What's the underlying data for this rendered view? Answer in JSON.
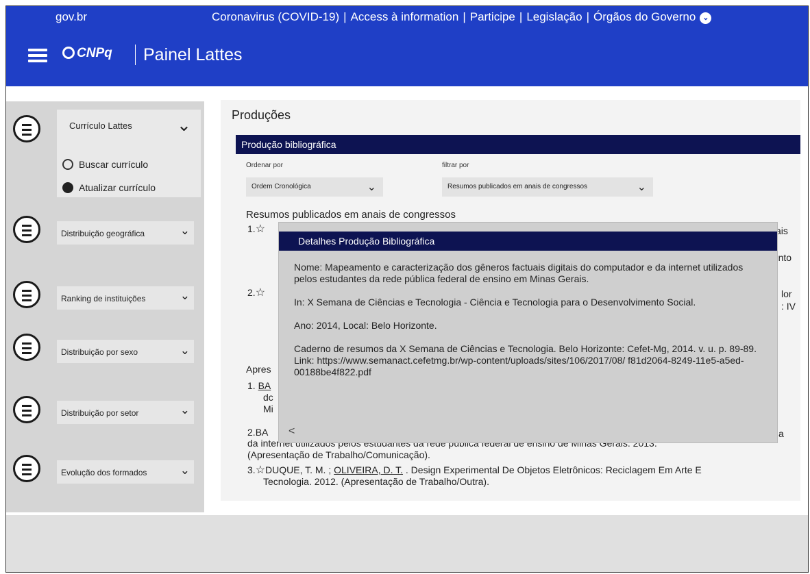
{
  "header": {
    "gov_label": "gov.br",
    "links": [
      "Coronavirus (COVID-19)",
      "Access à information",
      "Participe",
      "Legislação",
      "Órgãos do Governo"
    ],
    "logo_text": "CNPq",
    "title": "Painel Lattes"
  },
  "sidebar": {
    "curriculo": {
      "label": "Currículo Lattes",
      "sub_items": [
        {
          "label": "Buscar currículo",
          "icon": "search-icon"
        },
        {
          "label": "Atualizar currículo",
          "icon": "refresh-icon"
        }
      ]
    },
    "items": [
      {
        "label": "Distribuição geográfica"
      },
      {
        "label": "Ranking de instituições"
      },
      {
        "label": "Distribuição por sexo"
      },
      {
        "label": "Distribuição por setor"
      },
      {
        "label": "Evolução dos formados"
      }
    ]
  },
  "main": {
    "title": "Produções",
    "section_bar": "Produção bibliográfica",
    "order_label": "Ordenar por",
    "order_value": "Ordem Cronológica",
    "filter_label": "filtrar por",
    "filter_value": "Resumos publicados em anais de congressos",
    "list_title": "Resumos publicados em anais de congressos",
    "item1_num": "1.",
    "item2_num": "2.",
    "item1_tail": "ais",
    "item1_tail2": "nento",
    "item2_tail": "lor",
    "item2_tail2": ": IV",
    "apres_frag": "Apres",
    "apres1_num": "1.",
    "apres1_frag": "BA",
    "apres1_frag2": "dc",
    "apres1_frag3": "Mi",
    "apres2_num": "2.",
    "apres2_frag": "BA",
    "apres2_tail": "a",
    "apres2_line2": "da internet utilizados pelos estudantes da rede pública federal de ensino de Minas Gerais. 2013.",
    "apres2_line3": "(Apresentação de Trabalho/Comunicação).",
    "apres3_num": "3.",
    "apres3_line1_a": "DUQUE, T. M. ; ",
    "apres3_line1_u": "OLIVEIRA, D. T.",
    "apres3_line1_b": " . Design Experimental De Objetos Eletrônicos: Reciclagem Em Arte E",
    "apres3_line2": "Tecnologia. 2012. (Apresentação de Trabalho/Outra)."
  },
  "modal": {
    "title": "Detalhes  Produção Bibliográfica",
    "nome": "Nome: Mapeamento e caracterização dos gêneros factuais digitais do computador e da internet utilizados pelos estudantes da rede pública federal de ensino em Minas  Gerais.",
    "in": "In: X Semana de Ciências e Tecnologia - Ciência e Tecnologia para o Desenvolvimento Social.",
    "ano": "Ano: 2014,  Local: Belo Horizonte.",
    "caderno": "Caderno de resumos da X Semana de Ciências e Tecnologia. Belo Horizonte: Cefet-Mg, 2014. v. u. p. 89-89.",
    "link": "Link: https://www.semanact.cefetmg.br/wp-content/uploads/sites/106/2017/08/ f81d2064-8249-11e5-a5ed-00188be4f822.pdf",
    "back": "<"
  }
}
